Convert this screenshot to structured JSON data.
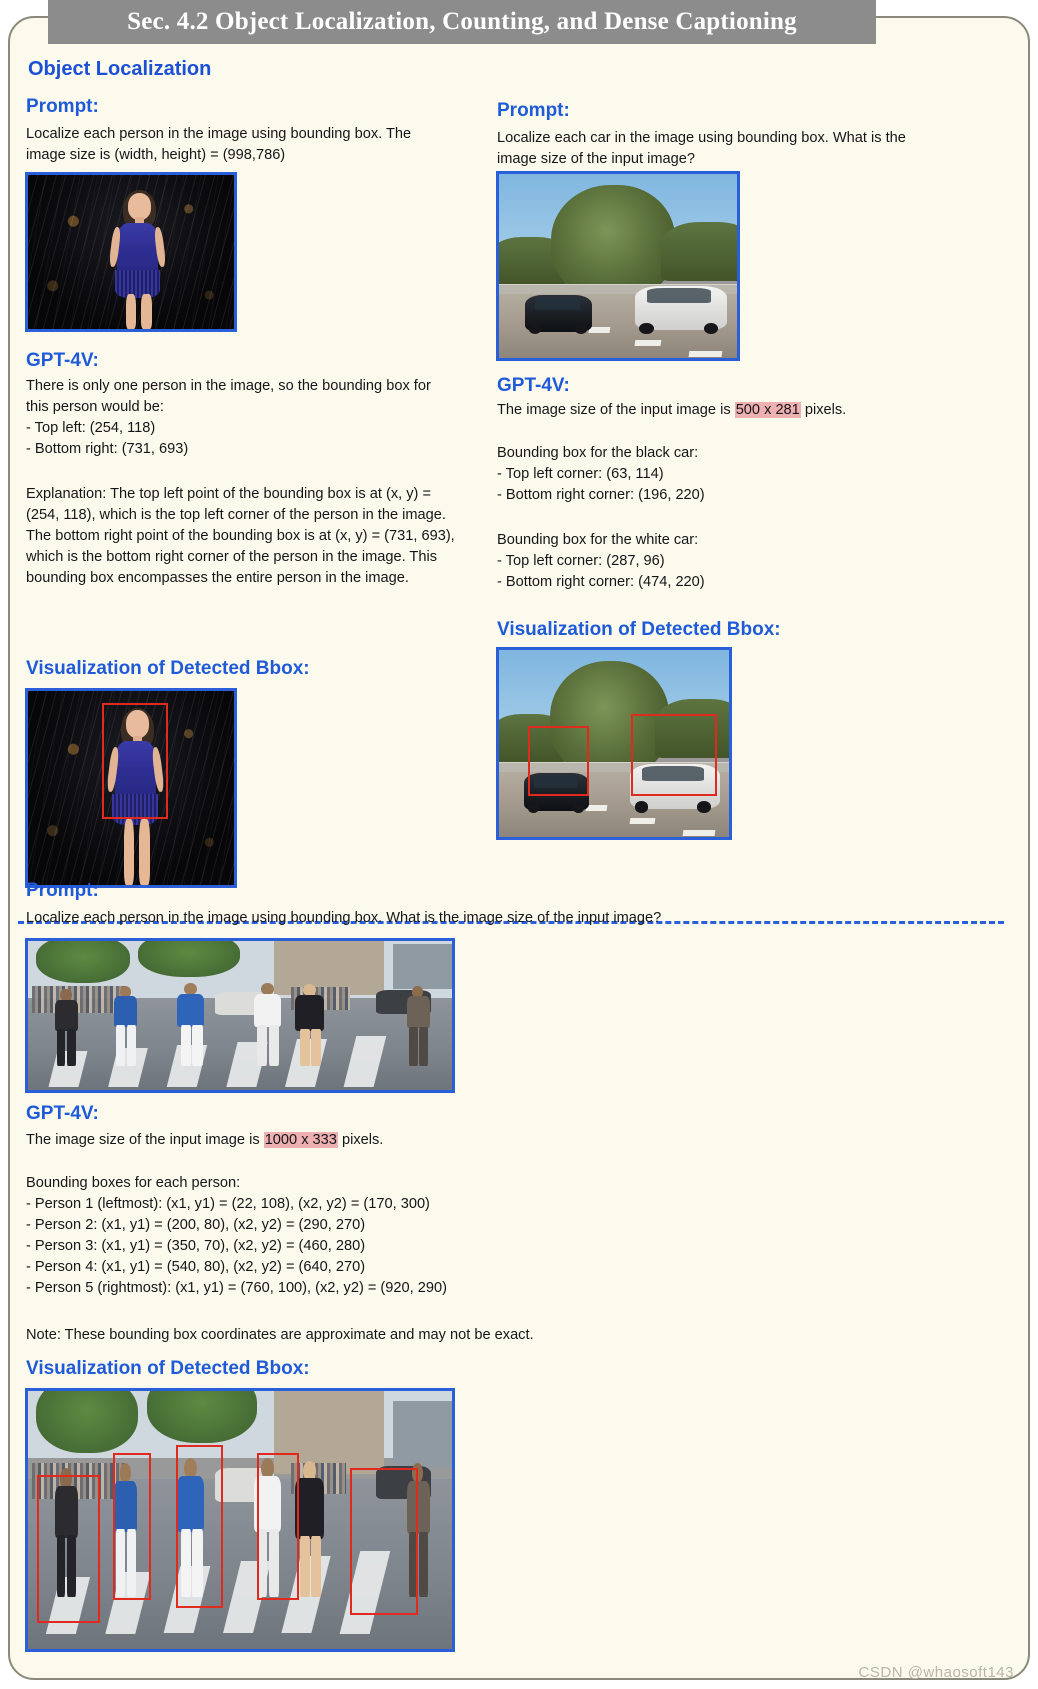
{
  "header": {
    "title": "Sec. 4.2 Object Localization, Counting, and Dense Captioning"
  },
  "section": {
    "heading": "Object Localization"
  },
  "labels": {
    "prompt": "Prompt:",
    "gpt4v": "GPT-4V:",
    "visualization": "Visualization of Detected Bbox:"
  },
  "panel_left": {
    "prompt_label": "Prompt:",
    "prompt_text": "Localize each person in the image using bounding box. The image size is (width, height) = (998,786)",
    "gpt_label": "GPT-4V:",
    "answer_block_1": "There is only one person in the image, so the bounding box for this person would be:\n- Top left: (254, 118)\n- Bottom right: (731, 693)",
    "answer_block_2": "Explanation: The top left point of the bounding box is at (x, y) = (254, 118), which is the top left corner of the person in the image. The bottom right point of the bounding box is at (x, y) = (731, 693), which is the bottom right corner of the person in the image. This bounding box encompasses the entire person in the image.",
    "viz_label": "Visualization of Detected Bbox:",
    "image_alt": "singer-on-stage-photo",
    "viz_alt": "singer-on-stage-photo-with-bbox"
  },
  "panel_right": {
    "prompt_label": "Prompt:",
    "prompt_text": "Localize each car in the image using bounding box. What is the image size of the input image?",
    "gpt_label": "GPT-4V:",
    "answer_prefix": "The image size of the input image is ",
    "answer_highlight": "500 x 281",
    "answer_suffix": " pixels.",
    "black_car_block": "Bounding box for the black car:\n- Top left corner: (63, 114)\n- Bottom right corner: (196, 220)",
    "white_car_block": "Bounding box for the white car:\n- Top left corner: (287, 96)\n- Bottom right corner: (474, 220)",
    "viz_label": "Visualization of Detected Bbox:",
    "image_alt": "highway-two-cars-photo",
    "viz_alt": "highway-two-cars-photo-with-bbox"
  },
  "panel_bottom": {
    "prompt_label": "Prompt:",
    "prompt_text": "Localize each person in the image using bounding box. What is the image size of the input image?",
    "gpt_label": "GPT-4V:",
    "answer_prefix": "The image size of the input image is ",
    "answer_highlight": "1000 x 333",
    "answer_suffix": " pixels.",
    "bbox_list": "Bounding boxes for each person:\n- Person 1 (leftmost): (x1, y1) = (22, 108), (x2, y2) = (170, 300)\n- Person 2: (x1, y1) = (200, 80), (x2, y2) = (290, 270)\n- Person 3: (x1, y1) = (350, 70), (x2, y2) = (460, 280)\n- Person 4: (x1, y1) = (540, 80), (x2, y2) = (640, 270)\n- Person 5 (rightmost): (x1, y1) = (760, 100), (x2, y2) = (920, 290)",
    "note": "Note: These bounding box coordinates are approximate and may not be exact.",
    "viz_label": "Visualization of Detected Bbox:",
    "image_alt": "crosswalk-pedestrians-photo",
    "viz_alt": "crosswalk-pedestrians-photo-with-bbox"
  },
  "watermark": "CSDN @whaosoft143",
  "colors": {
    "accent_blue": "#1f5bd8",
    "bbox_red": "#e02a1d",
    "highlight_pink": "#eeb0b0",
    "card_bg": "#fcfaec",
    "title_bar": "#8c8c8c"
  }
}
